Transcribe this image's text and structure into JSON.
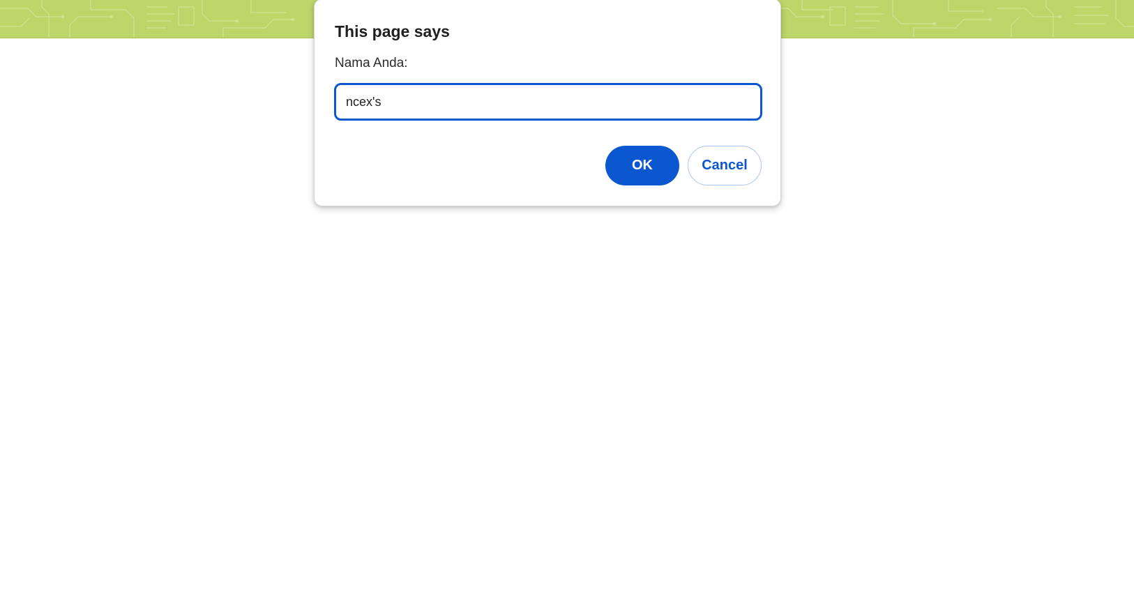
{
  "dialog": {
    "title": "This page says",
    "message": "Nama Anda:",
    "input_value": "ncex's",
    "ok_label": "OK",
    "cancel_label": "Cancel"
  },
  "colors": {
    "banner_green": "#bcd66a",
    "primary_blue": "#0b57d0",
    "cancel_border": "#a8c7fa"
  }
}
